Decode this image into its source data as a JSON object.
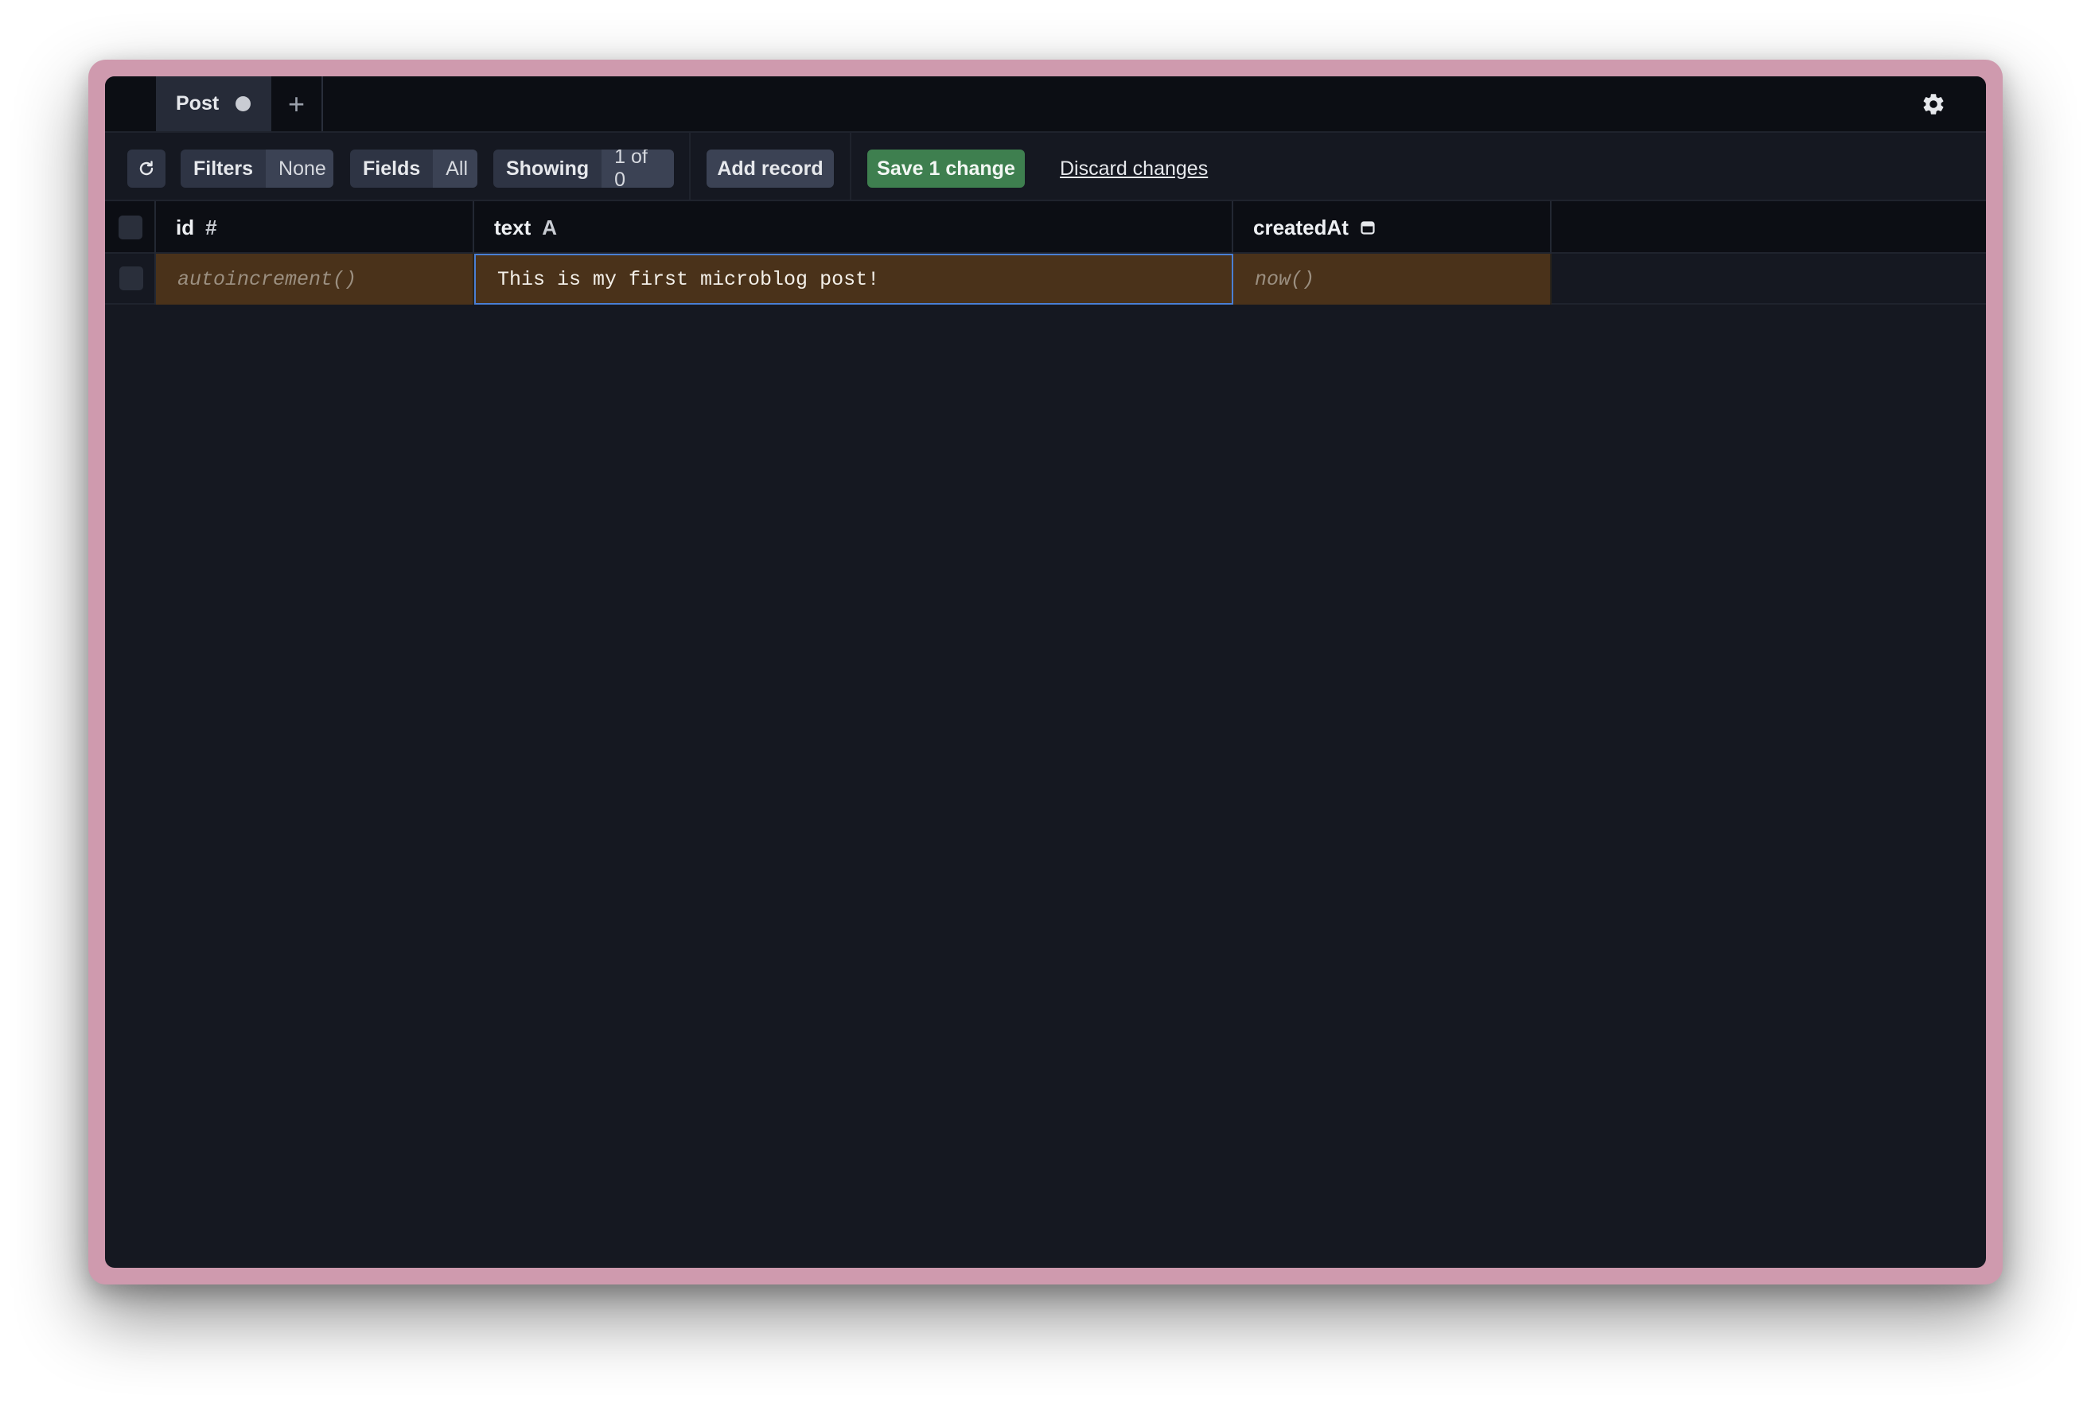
{
  "tabs": [
    {
      "label": "Post",
      "unsaved": true
    }
  ],
  "new_tab_label": "+",
  "toolbar": {
    "filters": {
      "key": "Filters",
      "value": "None"
    },
    "fields": {
      "key": "Fields",
      "value": "All"
    },
    "showing": {
      "key": "Showing",
      "value": "1 of 0"
    },
    "add_record_label": "Add record",
    "save_label": "Save 1 change",
    "discard_label": "Discard changes"
  },
  "table": {
    "columns": [
      {
        "name": "id",
        "type_icon": "#",
        "type_icon_name": "hash-icon"
      },
      {
        "name": "text",
        "type_icon": "A",
        "type_icon_name": "text-type-icon"
      },
      {
        "name": "createdAt",
        "type_icon": "",
        "type_icon_name": "calendar-icon"
      }
    ],
    "rows": [
      {
        "cells": [
          "autoincrement()",
          "This is my first microblog post!",
          "now()"
        ]
      }
    ]
  },
  "colors": {
    "frame": "#cf9aae",
    "background": "#151821",
    "save_green": "#3e7f4f",
    "pending_row": "#4a321a",
    "selection_blue": "#4a7fd4"
  }
}
